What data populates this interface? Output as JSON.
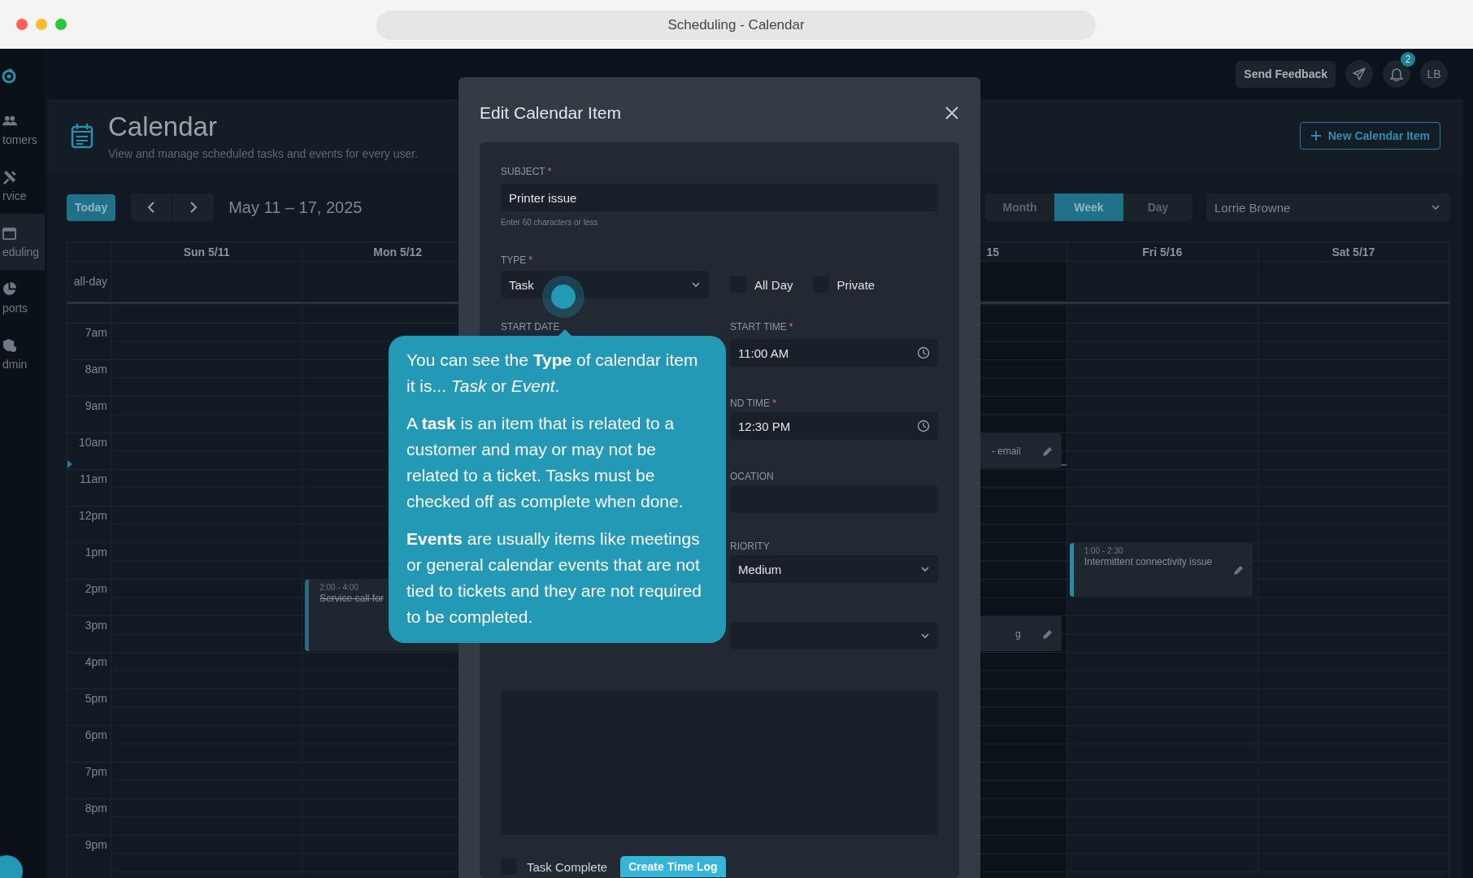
{
  "browser": {
    "title": "Scheduling - Calendar"
  },
  "sidebar": {
    "items": [
      {
        "label": "tomers",
        "selected": false
      },
      {
        "label": "rvice",
        "selected": false
      },
      {
        "label": "eduling",
        "selected": true
      },
      {
        "label": "ports",
        "selected": false
      },
      {
        "label": "dmin",
        "selected": false
      }
    ]
  },
  "topbar": {
    "feedback_button": "Send Feedback",
    "notifications_badge": "2",
    "avatar": "LB"
  },
  "header": {
    "title": "Calendar",
    "subtitle": "View and manage scheduled tasks and events for every user.",
    "new_button": "New Calendar Item"
  },
  "toolbar": {
    "today_button": "Today",
    "date_range": "May 11 – 17, 2025",
    "views": [
      {
        "label": "Month",
        "selected": false
      },
      {
        "label": "Week",
        "selected": true
      },
      {
        "label": "Day",
        "selected": false
      }
    ],
    "user_select": "Lorrie Browne"
  },
  "calendar": {
    "all_day_label": "all-day",
    "hours": [
      "7am",
      "8am",
      "9am",
      "10am",
      "11am",
      "12pm",
      "1pm",
      "2pm",
      "3pm",
      "4pm",
      "5pm",
      "6pm",
      "7pm",
      "8pm",
      "9pm"
    ],
    "days": [
      {
        "label": "Sun 5/11",
        "today": false
      },
      {
        "label": "Mon 5/12",
        "today": false,
        "events": [
          {
            "time": "2:00 - 4:00",
            "title": "Service call for",
            "completed": true
          }
        ]
      },
      {
        "label": "15",
        "today": true,
        "events": [
          {
            "title": "- email",
            "completed": false
          },
          {
            "title": "g",
            "completed": false
          }
        ]
      },
      {
        "label": "Fri 5/16",
        "today": false,
        "events": [
          {
            "time": "1:00 - 2:30",
            "title": "Intermittent connectivity issue",
            "completed": false
          }
        ]
      },
      {
        "label": "Sat 5/17",
        "today": false
      }
    ]
  },
  "modal": {
    "title": "Edit Calendar Item",
    "subject": {
      "label": "SUBJECT",
      "mark": "*",
      "value": "Printer issue",
      "hint": "Enter 60 characters or less"
    },
    "type": {
      "label": "TYPE",
      "mark": "*",
      "value": "Task"
    },
    "options": [
      {
        "label": "All Day",
        "checked": false
      },
      {
        "label": "Private",
        "checked": false
      }
    ],
    "start_date": {
      "label": "START DATE"
    },
    "start_time": {
      "label": "START TIME",
      "mark": "*",
      "value": "11:00 AM"
    },
    "end_time": {
      "label": "ND TIME",
      "mark": "*",
      "value": "12:30 PM"
    },
    "location": {
      "label": "OCATION"
    },
    "priority": {
      "label": "RIORITY",
      "value": "Medium"
    },
    "task_complete": {
      "label": "Task Complete",
      "checked": false
    },
    "time_log_button": "Create Time Log"
  },
  "tooltip": {
    "paragraphs": [
      "You can see the **Type** of calendar item it is... *Task* or *Event*.",
      "A **task** is an item that is related to a customer and may or may not be related to a ticket. Tasks must be checked off as complete when done.",
      "**Events** are usually items like meetings or general calendar events that are not tied to tickets and they are not required to be completed."
    ]
  }
}
